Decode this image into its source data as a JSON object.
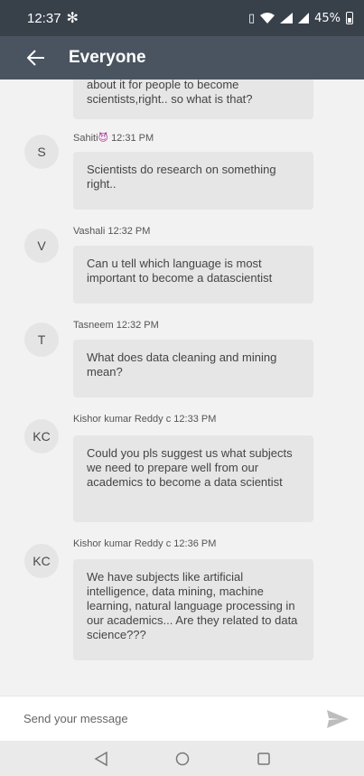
{
  "status": {
    "time": "12:37",
    "battery": "45%"
  },
  "header": {
    "title": "Everyone"
  },
  "partial_message": {
    "text": "about it for people to become scientists,right.. so what is that?"
  },
  "messages": [
    {
      "initials": "S",
      "sender": "Sahiti",
      "emoji": "😈",
      "time": "12:31 PM",
      "text": "Scientists do research on something right.."
    },
    {
      "initials": "V",
      "sender": "Vashali",
      "time": "12:32 PM",
      "text": "Can u tell which language is most important to become a datascientist"
    },
    {
      "initials": "T",
      "sender": "Tasneem",
      "time": "12:32 PM",
      "text": "What does data cleaning and mining mean?"
    },
    {
      "initials": "KC",
      "sender": "Kishor kumar Reddy c",
      "time": "12:33 PM",
      "text": "Could you pls suggest us what subjects we need to prepare well from our academics to become a data scientist"
    },
    {
      "initials": "KC",
      "sender": "Kishor kumar Reddy c",
      "time": "12:36 PM",
      "text": "We have subjects like artificial intelligence, data mining, machine learning, natural language processing in our academics... Are they related to data science???"
    }
  ],
  "composer": {
    "placeholder": "Send your message"
  },
  "icons": {
    "back": "arrow-left-icon",
    "send": "send-icon",
    "nav_back": "triangle-back-icon",
    "nav_home": "circle-home-icon",
    "nav_recents": "square-recents-icon"
  }
}
